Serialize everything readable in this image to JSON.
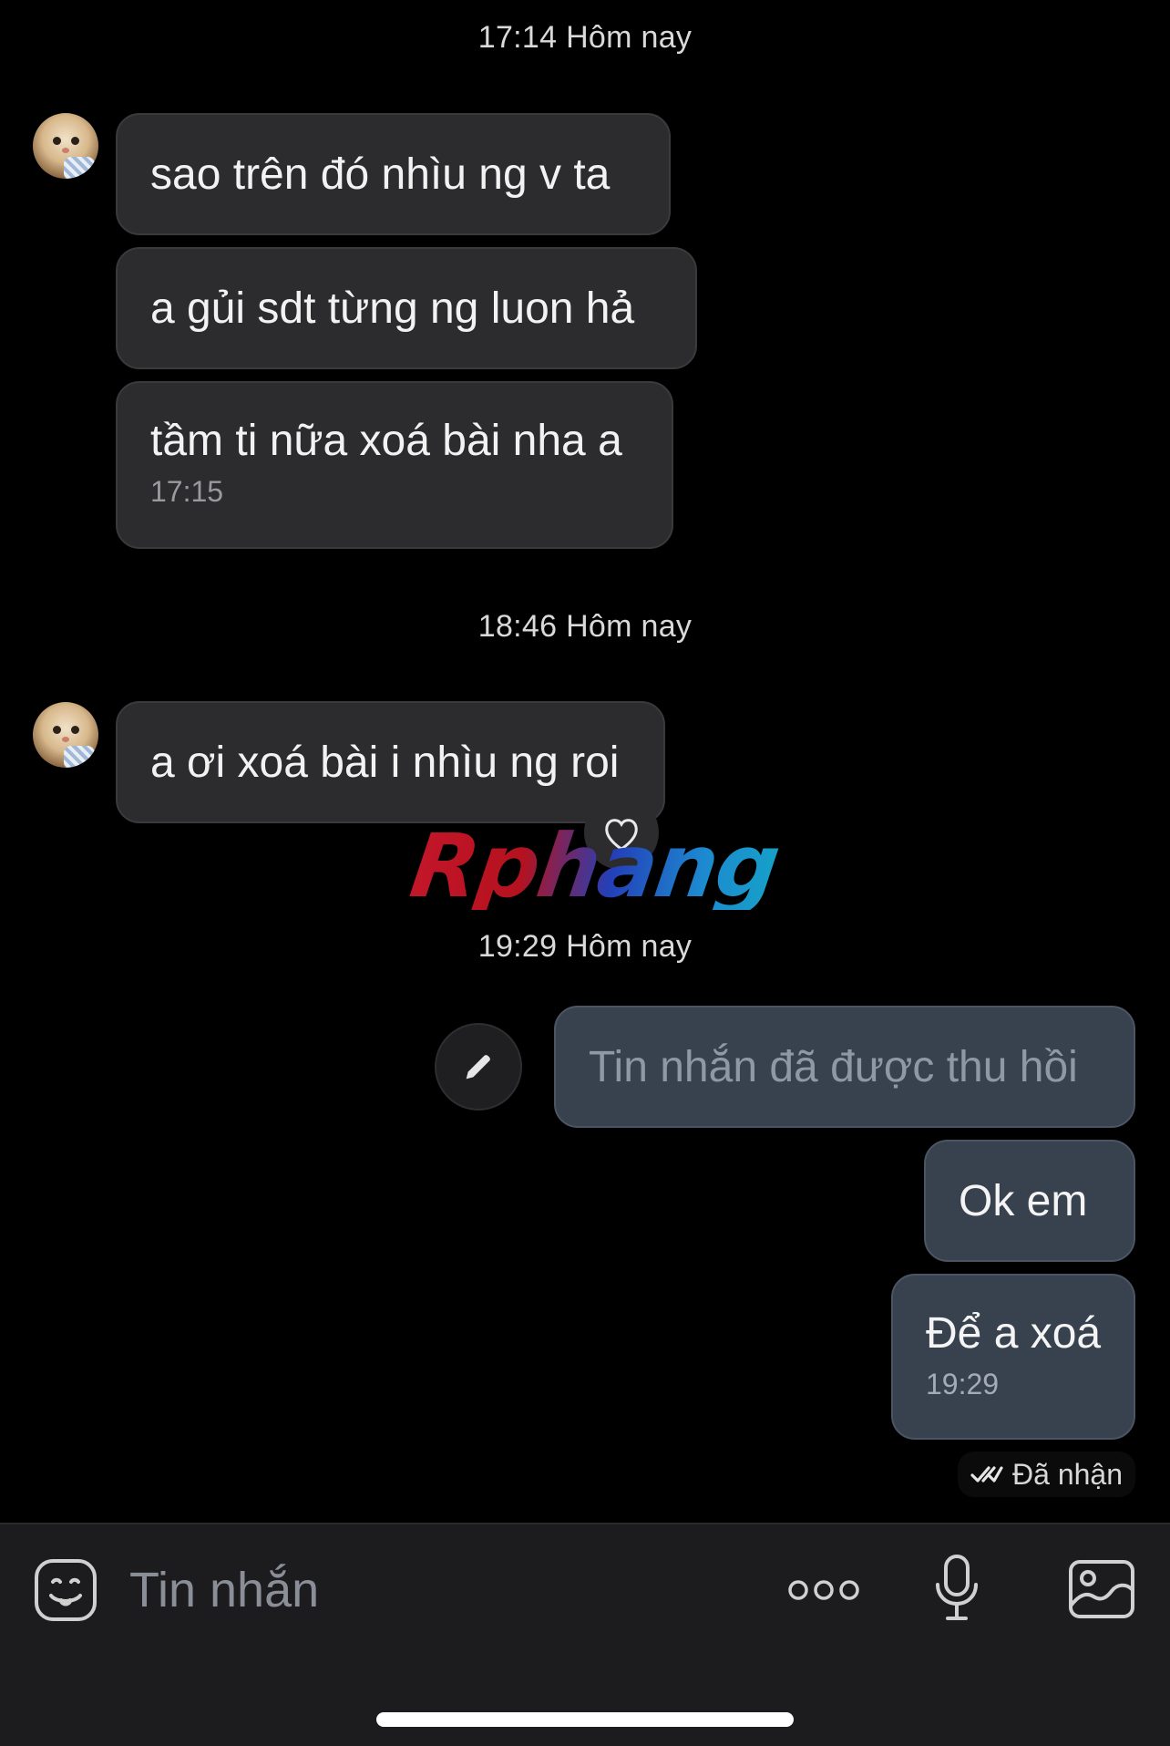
{
  "separators": [
    {
      "text": "17:14 Hôm nay"
    },
    {
      "text": "18:46 Hôm nay"
    },
    {
      "text": "19:29 Hôm nay"
    }
  ],
  "incoming": [
    {
      "text": "sao trên đó nhìu ng v ta"
    },
    {
      "text": "a gủi sdt từng ng luon hả"
    },
    {
      "text": "tầm ti nữa xoá bài nha a",
      "time": "17:15"
    },
    {
      "text": "a ơi xoá bài i nhìu ng roi"
    }
  ],
  "outgoing": [
    {
      "text": "Tin nhắn đã được thu hồi"
    },
    {
      "text": "Ok em"
    },
    {
      "text": "Để a xoá",
      "time": "19:29"
    }
  ],
  "delivery_status": "Đã nhận",
  "watermark": "Rphang",
  "composer": {
    "placeholder": "Tin nhắn"
  },
  "icons": {
    "emoji": "emoji-icon",
    "more": "more-dots-icon",
    "mic": "microphone-icon",
    "image": "image-icon",
    "heart": "heart-icon",
    "edit": "pencil-icon",
    "status": "double-check-icon"
  }
}
